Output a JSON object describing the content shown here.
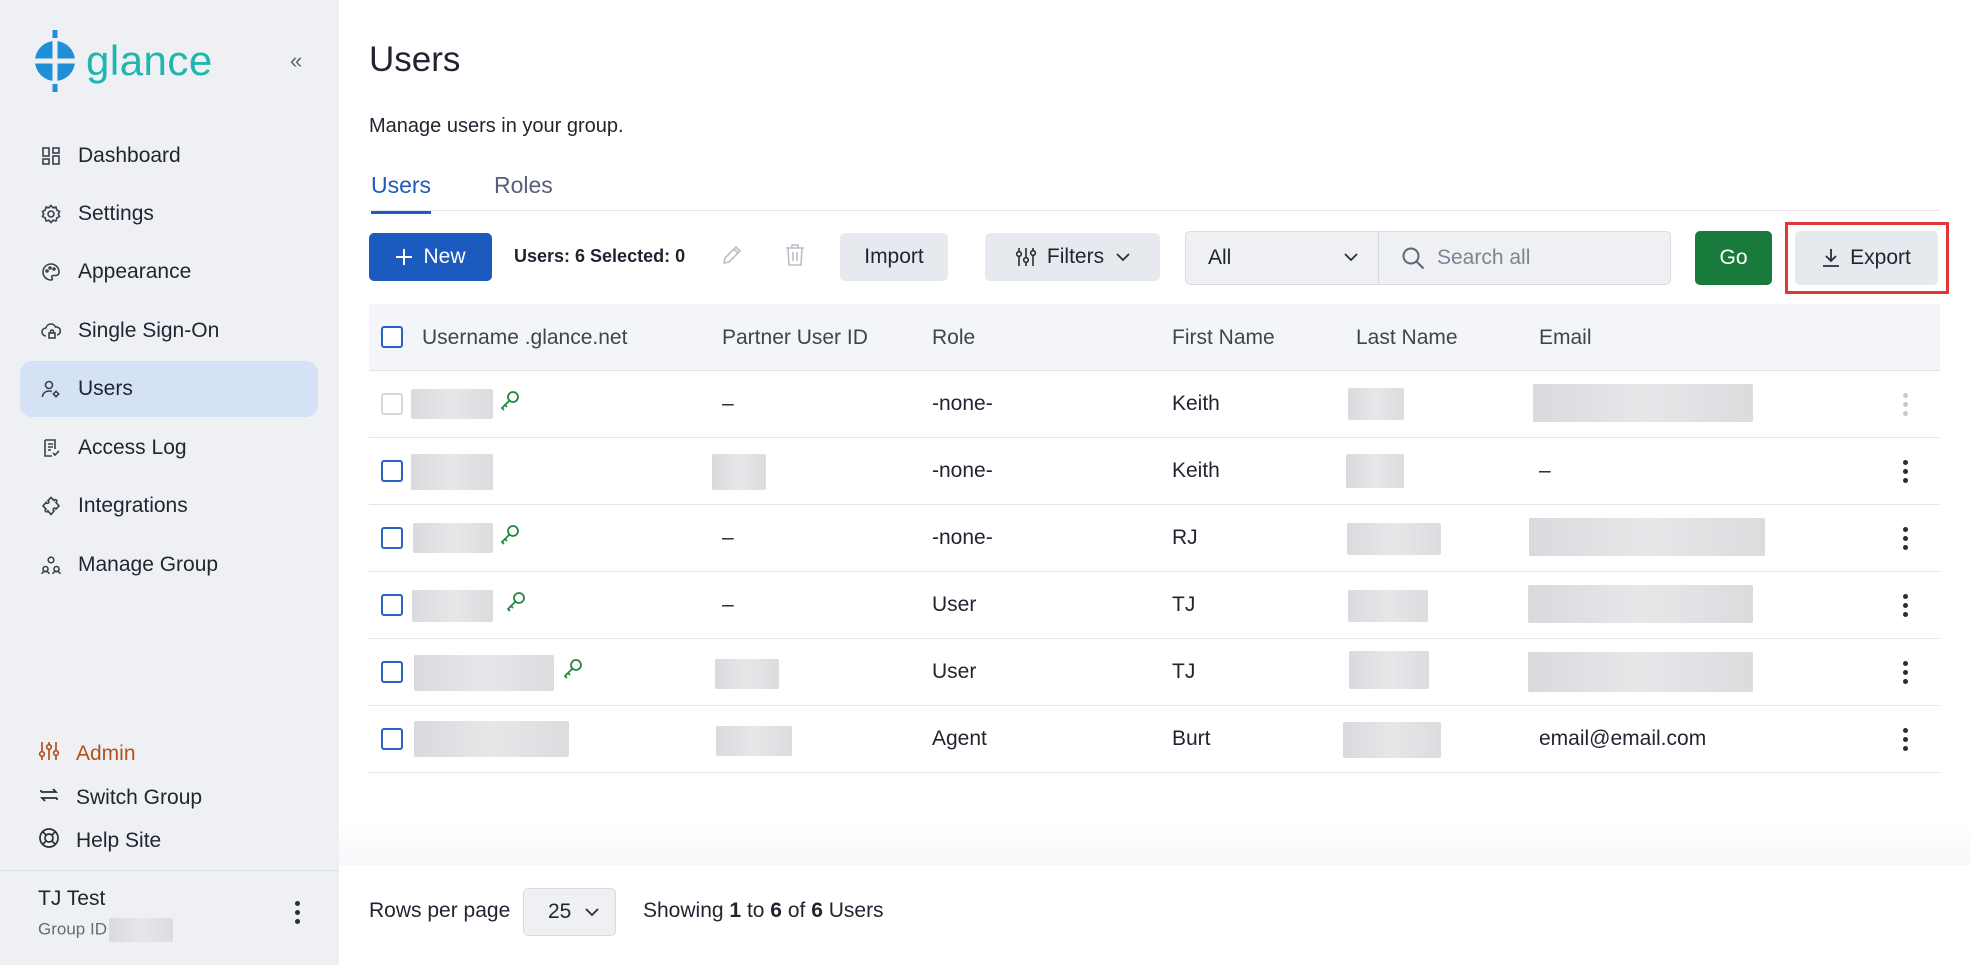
{
  "app": {
    "name": "glance",
    "brand_color": "#1fb6b0"
  },
  "sidebar": {
    "items": [
      {
        "label": "Dashboard",
        "icon": "dashboard-icon"
      },
      {
        "label": "Settings",
        "icon": "gear-icon"
      },
      {
        "label": "Appearance",
        "icon": "palette-icon"
      },
      {
        "label": "Single Sign-On",
        "icon": "cloud-lock-icon"
      },
      {
        "label": "Users",
        "icon": "user-gear-icon",
        "active": true
      },
      {
        "label": "Access Log",
        "icon": "log-icon"
      },
      {
        "label": "Integrations",
        "icon": "puzzle-icon"
      },
      {
        "label": "Manage Group",
        "icon": "group-icon"
      }
    ],
    "admin": {
      "label": "Admin",
      "color": "#b3521d"
    },
    "switch_group": "Switch Group",
    "help_site": "Help Site",
    "user": {
      "name": "TJ Test",
      "group_label": "Group ID"
    }
  },
  "page": {
    "title": "Users",
    "subtitle": "Manage users in your group.",
    "tabs": [
      {
        "label": "Users",
        "active": true
      },
      {
        "label": "Roles"
      }
    ]
  },
  "toolbar": {
    "new_label": "New",
    "counts_label": "Users: 6 Selected: 0",
    "import_label": "Import",
    "filters_label": "Filters",
    "scope_value": "All",
    "search_placeholder": "Search all",
    "go_label": "Go",
    "export_label": "Export"
  },
  "table": {
    "columns": [
      "Username .glance.net",
      "Partner User ID",
      "Role",
      "First Name",
      "Last Name",
      "Email"
    ],
    "rows": [
      {
        "partner_id": "–",
        "role": "-none-",
        "first": "Keith",
        "email": ""
      },
      {
        "partner_id": "",
        "role": "-none-",
        "first": "Keith",
        "email": "–"
      },
      {
        "partner_id": "–",
        "role": "-none-",
        "first": "RJ",
        "email": ""
      },
      {
        "partner_id": "–",
        "role": "User",
        "first": "TJ",
        "email": ""
      },
      {
        "partner_id": "",
        "role": "User",
        "first": "TJ",
        "email": ""
      },
      {
        "partner_id": "",
        "role": "Agent",
        "first": "Burt",
        "email": "email@email.com"
      }
    ]
  },
  "footer": {
    "rows_per_page_label": "Rows per page",
    "rows_per_page_value": "25",
    "showing_prefix": "Showing",
    "showing_from": "1",
    "showing_to_word": "to",
    "showing_to": "6",
    "showing_of_word": "of",
    "showing_total": "6",
    "showing_suffix": "Users"
  }
}
